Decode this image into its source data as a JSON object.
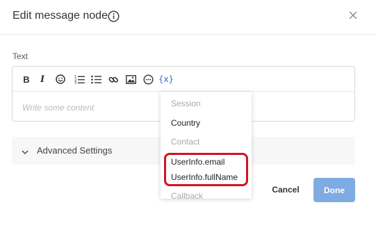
{
  "modal": {
    "title": "Edit message node",
    "close_icon": "close-icon",
    "info_icon": "info-icon"
  },
  "text_field": {
    "label": "Text",
    "placeholder": "Write some content"
  },
  "toolbar": {
    "bold": "B",
    "italic": "I",
    "emoji_icon": "emoji-icon",
    "ordered_list_icon": "ordered-list-icon",
    "bullet_list_icon": "bullet-list-icon",
    "link_icon": "link-icon",
    "image_icon": "image-icon",
    "more_icon": "more-icon",
    "variable": "{x}"
  },
  "variable_dropdown": {
    "items": [
      {
        "type": "group",
        "label": "Session"
      },
      {
        "type": "option",
        "label": "Country"
      },
      {
        "type": "group",
        "label": "Contact"
      },
      {
        "type": "option",
        "label": "UserInfo.email"
      },
      {
        "type": "option",
        "label": "UserInfo.fullName"
      },
      {
        "type": "group",
        "label": "Callback"
      }
    ]
  },
  "advanced_settings": {
    "label": "Advanced Settings"
  },
  "footer": {
    "cancel_label": "Cancel",
    "done_label": "Done"
  },
  "colors": {
    "primary_disabled": "#7fabe3",
    "highlight": "#d0141f",
    "variable_accent": "#2f6fd1"
  }
}
